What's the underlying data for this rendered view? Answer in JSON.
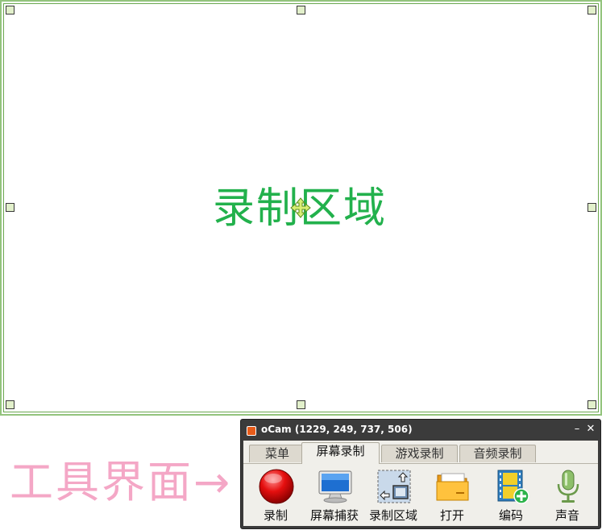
{
  "region": {
    "label": "录制区域"
  },
  "annotation": {
    "text": "工具界面→"
  },
  "window": {
    "title": "oCam (1229, 249, 737, 506)",
    "minimize_glyph": "–",
    "close_glyph": "✕",
    "tabs": [
      {
        "label": "菜单",
        "active": false
      },
      {
        "label": "屏幕录制",
        "active": true
      },
      {
        "label": "游戏录制",
        "active": false
      },
      {
        "label": "音频录制",
        "active": false
      }
    ],
    "toolbar": [
      {
        "label": "录制",
        "icon": "record-icon"
      },
      {
        "label": "屏幕捕获",
        "icon": "monitor-icon"
      },
      {
        "label": "录制区域",
        "icon": "resize-region-icon"
      },
      {
        "label": "打开",
        "icon": "folder-icon"
      },
      {
        "label": "编码",
        "icon": "film-add-icon"
      },
      {
        "label": "声音",
        "icon": "microphone-icon"
      }
    ]
  },
  "colors": {
    "region_border": "#93c47d",
    "region_label": "#22b14c",
    "annotation": "#f4a7c6",
    "window_frame": "#3b3b3b"
  }
}
